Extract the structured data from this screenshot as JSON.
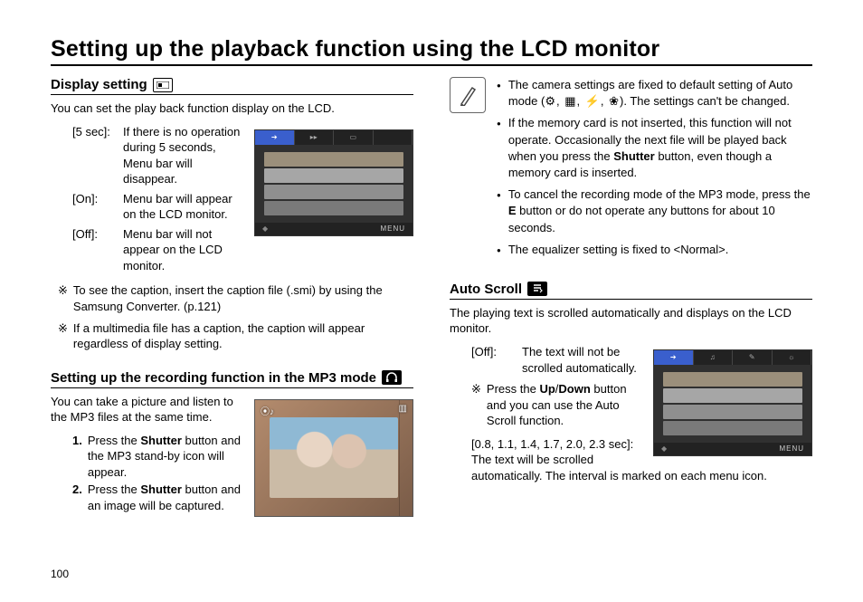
{
  "page_number": "100",
  "title": "Setting up the playback function using the LCD monitor",
  "left": {
    "display_setting": {
      "heading": "Display setting",
      "intro": "You can set the play back function display on the LCD.",
      "options": [
        {
          "key": "[5 sec]:",
          "val": "If there is no operation during 5 seconds, Menu bar will disappear."
        },
        {
          "key": "[On]:",
          "val": "Menu bar will appear on the LCD monitor."
        },
        {
          "key": "[Off]:",
          "val": "Menu bar will not appear on the LCD monitor."
        }
      ],
      "notes": [
        "To see the caption, insert the caption file (.smi) by using the Samsung Converter. (p.121)",
        "If a multimedia file has a caption, the caption will appear regardless of display setting."
      ],
      "lcd_menu_label": "MENU"
    },
    "mp3": {
      "heading": "Setting up the recording function in the MP3 mode",
      "intro": "You can take a picture and listen to the MP3 files at the same time.",
      "steps": [
        {
          "num": "1.",
          "text_a": "Press the ",
          "bold_a": "Shutter",
          "text_b": " button and the MP3 stand-by icon will appear."
        },
        {
          "num": "2.",
          "text_a": "Press the ",
          "bold_a": "Shutter",
          "text_b": " button and an image will be captured."
        }
      ]
    }
  },
  "right": {
    "camera_notes": {
      "items": [
        {
          "pre": "The camera settings are fixed to default setting of Auto mode (",
          "icons": "⚙, ▦, ⚡, ❀",
          "post": "). The settings can't be changed."
        },
        {
          "pre": "If the memory card is not inserted, this function will not operate. Occasionally the next file will be played back when you press the ",
          "bold": "Shutter",
          "post": " button, even though a memory card is inserted."
        },
        {
          "pre": "To cancel the recording mode of the MP3 mode, press the ",
          "bold": "E",
          "post": " button or do not operate any buttons for about 10 seconds."
        },
        {
          "pre": "The equalizer setting is fixed to <Normal>.",
          "bold": "",
          "post": ""
        }
      ]
    },
    "auto_scroll": {
      "heading": "Auto Scroll",
      "intro": "The playing text is scrolled automatically and displays on the LCD monitor.",
      "off_key": "[Off]:",
      "off_val": "The text will not be scrolled automatically.",
      "tip_pre": "Press the ",
      "tip_bold1": "Up",
      "tip_slash": "/",
      "tip_bold2": "Down",
      "tip_post": " button and you can use the Auto Scroll function.",
      "range_label": "[0.8, 1.1, 1.4, 1.7, 2.0, 2.3 sec]:",
      "range_text": "The text will be scrolled automatically. The interval is marked on each menu icon.",
      "lcd_menu_label": "MENU"
    }
  }
}
